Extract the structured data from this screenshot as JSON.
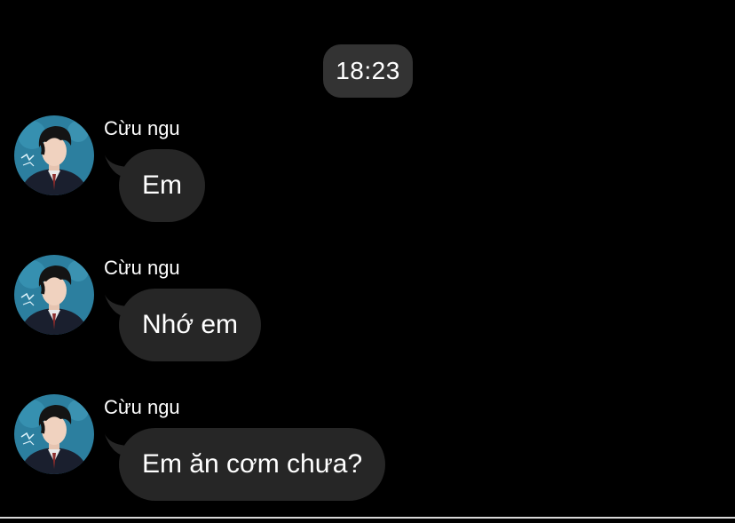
{
  "timestamp": "18:23",
  "colors": {
    "background": "#000000",
    "timestamp_pill": "#333333",
    "bubble": "#262626",
    "text": "#ffffff",
    "avatar_bg": "#2c7f9f"
  },
  "messages": [
    {
      "sender": "Cừu ngu",
      "text": "Em",
      "avatar_icon": "contact-avatar"
    },
    {
      "sender": "Cừu ngu",
      "text": "Nhớ em",
      "avatar_icon": "contact-avatar"
    },
    {
      "sender": "Cừu ngu",
      "text": "Em ăn cơm chưa?",
      "avatar_icon": "contact-avatar"
    }
  ]
}
